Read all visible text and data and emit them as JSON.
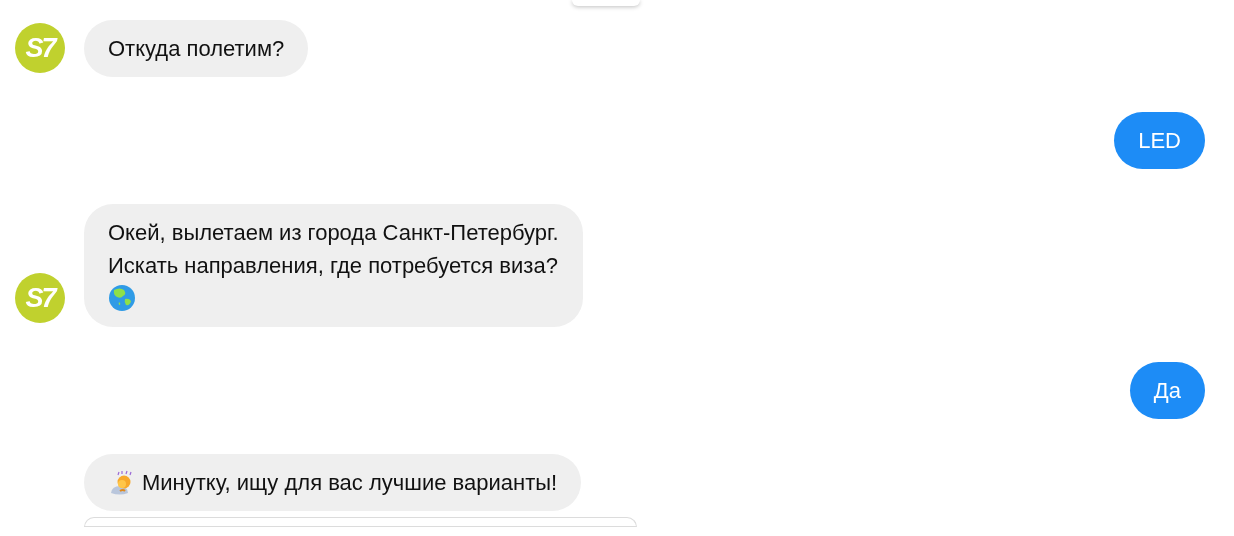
{
  "messages": [
    {
      "kind": "card-top"
    },
    {
      "kind": "bot",
      "avatar": {
        "label": "S7"
      },
      "text": "Откуда полетим?"
    },
    {
      "kind": "user",
      "text": "LED"
    },
    {
      "kind": "bot",
      "avatar": {
        "label": "S7"
      },
      "text": "Окей, вылетаем из города Санкт-Петербург.\nИскать направления, где потребуется виза?"
    },
    {
      "kind": "user",
      "text": "Да"
    },
    {
      "kind": "bot",
      "text": "Минутку, ищу для вас лучшие варианты!"
    },
    {
      "kind": "card-bottom"
    }
  ]
}
